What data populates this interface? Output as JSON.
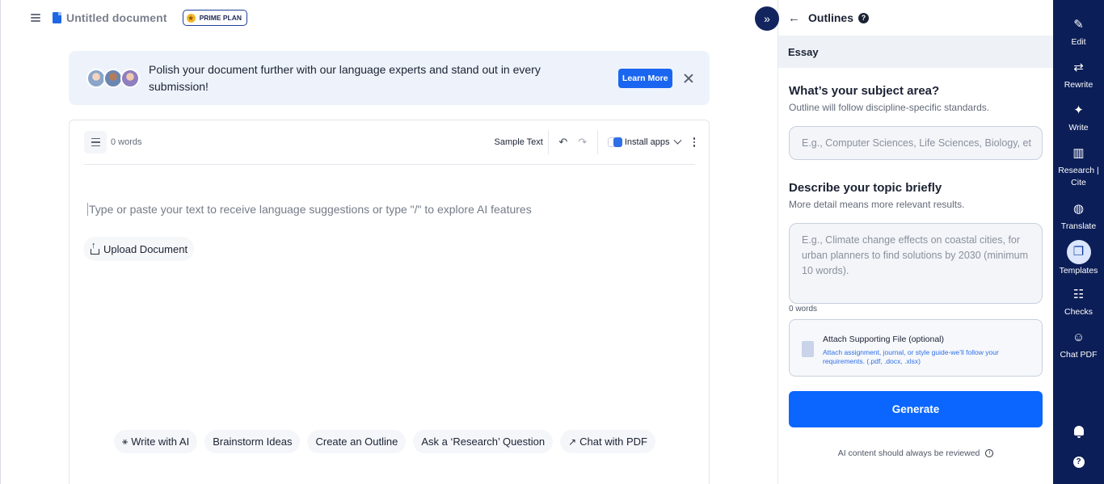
{
  "header": {
    "document_title": "Untitled document",
    "plan_badge": "PRIME PLAN"
  },
  "banner": {
    "text": "Polish your document further with our language experts and stand out in every submission!",
    "learn_more": "Learn More"
  },
  "editor": {
    "word_count": "0 words",
    "sample_text": "Sample Text",
    "install_apps": "Install apps",
    "placeholder": "Type or paste your text to receive language suggestions or type \"/\" to explore AI features",
    "upload_label": "Upload Document",
    "chips": [
      {
        "label": "Write with AI",
        "icon": "magic-wand-icon"
      },
      {
        "label": "Brainstorm Ideas"
      },
      {
        "label": "Create an Outline"
      },
      {
        "label": "Ask a ‘Research’ Question"
      },
      {
        "label": "Chat with PDF",
        "icon": "arrow-up-right-icon"
      }
    ]
  },
  "panel": {
    "title": "Outlines",
    "template": "Essay",
    "subject": {
      "title": "What’s your subject area?",
      "subtitle": "Outline will follow discipline-specific standards.",
      "placeholder": "E.g., Computer Sciences, Life Sciences, Biology, et"
    },
    "topic": {
      "title": "Describe your topic briefly",
      "subtitle": "More detail means more relevant results.",
      "placeholder": "E.g., Climate change effects on coastal cities, for urban planners to find solutions by 2030 (minimum 10 words).",
      "word_count": "0 words"
    },
    "attach": {
      "title": "Attach Supporting File (optional)",
      "description": "Attach assignment, journal, or style guide-we’ll follow your requirements. (.pdf, .docx, .xlsx)"
    },
    "generate": "Generate",
    "disclaimer": "AI content should always be reviewed"
  },
  "rail": {
    "items": [
      {
        "label": "Edit",
        "icon": "feather-pen-icon"
      },
      {
        "label": "Rewrite",
        "icon": "rewrite-arrows-icon"
      },
      {
        "label": "Write",
        "icon": "sparkle-icon"
      },
      {
        "label": "Research | Cite",
        "icon": "books-icon"
      },
      {
        "label": "Translate",
        "icon": "globe-icon"
      },
      {
        "label": "Templates",
        "icon": "templates-icon",
        "active": true
      },
      {
        "label": "Checks",
        "icon": "checklist-icon"
      },
      {
        "label": "Chat PDF",
        "icon": "chat-icon"
      }
    ]
  },
  "colors": {
    "accent": "#0a66ff",
    "rail_bg": "#0b1e57",
    "banner_bg": "#eef3fb"
  }
}
